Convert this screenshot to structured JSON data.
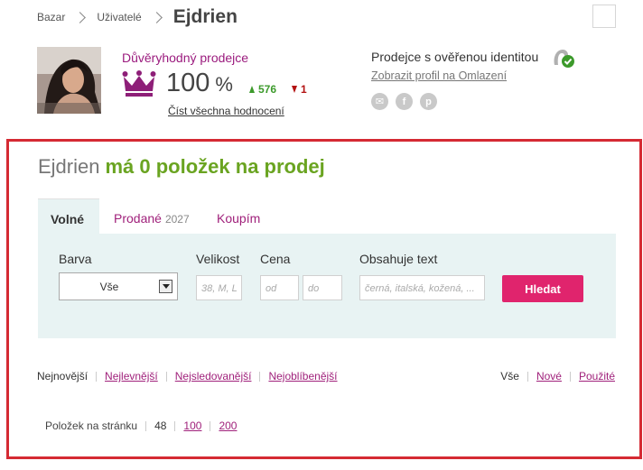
{
  "breadcrumb": {
    "items": [
      "Bazar",
      "Uživatelé"
    ],
    "current": "Ejdrien"
  },
  "seller": {
    "trusted_label": "Důvěryhodný prodejce",
    "rating": "100",
    "rating_unit": "%",
    "positive": "576",
    "negative": "1",
    "read_all": "Číst všechna hodnocení",
    "verified_label": "Prodejce s ověřenou identitou",
    "profile_link": "Zobrazit profil na Omlazení",
    "social_icons": [
      "mail-icon",
      "facebook-icon",
      "pinterest-icon"
    ]
  },
  "listing": {
    "user": "Ejdrien",
    "headline_rest": "má 0 položek na prodej"
  },
  "tabs": {
    "free": "Volné",
    "sold": "Prodané",
    "sold_count": "2027",
    "bought": "Koupím"
  },
  "filters": {
    "color_label": "Barva",
    "color_value": "Vše",
    "size_label": "Velikost",
    "size_placeholder": "38, M, L",
    "price_label": "Cena",
    "price_from_placeholder": "od",
    "price_to_placeholder": "do",
    "text_label": "Obsahuje text",
    "text_placeholder": "černá, italská, kožená, ...",
    "search_button": "Hledat"
  },
  "sort": {
    "newest": "Nejnovější",
    "cheapest": "Nejlevnější",
    "most_watched": "Nejsledovanější",
    "most_popular": "Nejoblíbenější"
  },
  "condition": {
    "all": "Vše",
    "new": "Nové",
    "used": "Použité"
  },
  "per_page": {
    "label": "Položek na stránku",
    "current": "48",
    "opt100": "100",
    "opt200": "200"
  },
  "colors": {
    "accent_pink": "#a0217b",
    "accent_green": "#6aa421",
    "search_button": "#e0246d",
    "frame_red": "#d52a33"
  }
}
